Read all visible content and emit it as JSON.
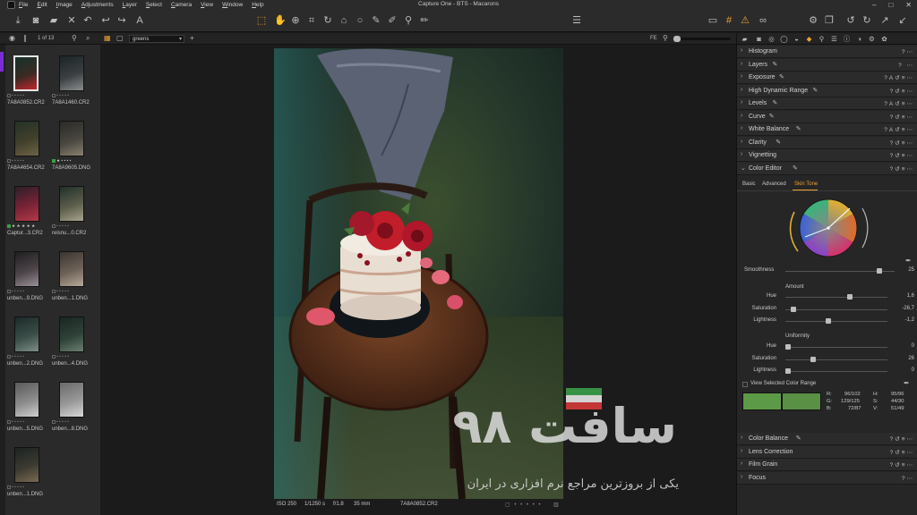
{
  "app": {
    "title": "Capture One - BTS - Macarons",
    "menu": [
      "File",
      "Edit",
      "Image",
      "Adjustments",
      "Layer",
      "Select",
      "Camera",
      "View",
      "Window",
      "Help"
    ],
    "window_controls": [
      "–",
      "□",
      "✕"
    ]
  },
  "browser_bar": {
    "counter": "1 of 13",
    "collection": "greens",
    "filter_label": "FE"
  },
  "thumbnails": [
    {
      "name": "7A8A0852.CR2",
      "stars": 0,
      "label": "",
      "selected": true,
      "colors": [
        "#16322b",
        "#3a2a24",
        "#c2262c"
      ]
    },
    {
      "name": "7A8A1460.CR2",
      "stars": 0,
      "label": "",
      "selected": false,
      "colors": [
        "#1c2426",
        "#3b3f42",
        "#8b8e8e"
      ]
    },
    {
      "name": "7A8A4654.CR2",
      "stars": 0,
      "label": "",
      "selected": false,
      "colors": [
        "#243126",
        "#42402c",
        "#6d6345"
      ]
    },
    {
      "name": "7A8A9605.DNG",
      "stars": 1,
      "label": "green",
      "selected": false,
      "colors": [
        "#2a2a26",
        "#48463f",
        "#8a8070"
      ]
    },
    {
      "name": "Captur...3.CR2",
      "stars": 5,
      "label": "green",
      "selected": false,
      "colors": [
        "#2b2028",
        "#7a2236",
        "#b23a4a"
      ]
    },
    {
      "name": "reisnu...0.CR2",
      "stars": 0,
      "label": "",
      "selected": false,
      "colors": [
        "#223028",
        "#5c5e4c",
        "#a9a38e"
      ]
    },
    {
      "name": "unben...9.DNG",
      "stars": 0,
      "label": "",
      "selected": false,
      "colors": [
        "#1f1e20",
        "#4c4448",
        "#9b9098"
      ]
    },
    {
      "name": "unben...1.DNG",
      "stars": 0,
      "label": "",
      "selected": false,
      "colors": [
        "#3a3430",
        "#6e6258",
        "#b8a898"
      ]
    },
    {
      "name": "unben...2.DNG",
      "stars": 0,
      "label": "",
      "selected": false,
      "colors": [
        "#1d2a2a",
        "#3a4e48",
        "#7e8c88"
      ]
    },
    {
      "name": "unben...4.DNG",
      "stars": 0,
      "label": "",
      "selected": false,
      "colors": [
        "#1a2622",
        "#2e4238",
        "#6a7e70"
      ]
    },
    {
      "name": "unben...5.DNG",
      "stars": 0,
      "label": "",
      "selected": false,
      "colors": [
        "#5a5a5a",
        "#8c8c8c",
        "#cfcfcf"
      ]
    },
    {
      "name": "unben...8.DNG",
      "stars": 0,
      "label": "",
      "selected": false,
      "colors": [
        "#6a6a6a",
        "#989898",
        "#d8d8d8"
      ]
    },
    {
      "name": "unben...1.DNG",
      "stars": 0,
      "label": "",
      "selected": false,
      "colors": [
        "#1c2322",
        "#3c3a32",
        "#7a6a52"
      ]
    }
  ],
  "viewer": {
    "iso": "ISO 250",
    "shutter": "1/1250 s",
    "aperture": "f/1.8",
    "focal": "35 mm",
    "filename": "7A8A0852.CR2"
  },
  "watermark": {
    "main": "سافت ۹۸",
    "sub": "یکی از بروزترین مراجع نرم افزاری در ایران"
  },
  "tools": {
    "headers_top": [
      {
        "name": "Histogram",
        "pencil": false,
        "actions": "?⋯"
      },
      {
        "name": "Layers",
        "pencil": true,
        "actions": "? ⋯"
      },
      {
        "name": "Exposure",
        "pencil": true,
        "actions": "?A↺≡⋯"
      },
      {
        "name": "High Dynamic Range",
        "pencil": true,
        "actions": "?↺≡⋯"
      },
      {
        "name": "Levels",
        "pencil": true,
        "actions": "?A↺≡⋯"
      },
      {
        "name": "Curve",
        "pencil": true,
        "actions": "?↺≡⋯"
      },
      {
        "name": "White Balance",
        "pencil": true,
        "actions": "?A↺≡⋯"
      },
      {
        "name": "Clarity",
        "pencil": true,
        "actions": "?↺≡⋯"
      },
      {
        "name": "Vignetting",
        "pencil": false,
        "actions": "?↺≡⋯"
      },
      {
        "name": "Color Editor",
        "pencil": true,
        "actions": "?↺≡⋯"
      }
    ],
    "headers_bottom": [
      {
        "name": "Color Balance",
        "pencil": true,
        "actions": "?↺≡⋯"
      },
      {
        "name": "Lens Correction",
        "pencil": false,
        "actions": "?↺≡⋯"
      },
      {
        "name": "Film Grain",
        "pencil": false,
        "actions": "?↺≡⋯"
      },
      {
        "name": "Focus",
        "pencil": false,
        "actions": "?⋯"
      }
    ],
    "color_editor": {
      "tabs": [
        "Basic",
        "Advanced",
        "Skin Tone"
      ],
      "active_tab": "Skin Tone",
      "smoothness": {
        "label": "Smoothness",
        "value": "25",
        "position": 0.88
      },
      "amount_label": "Amount",
      "amount": [
        {
          "label": "Hue",
          "value": "1,6",
          "position": 0.64
        },
        {
          "label": "Saturation",
          "value": "-26,7",
          "position": 0.06
        },
        {
          "label": "Lightness",
          "value": "-1,2",
          "position": 0.42
        }
      ],
      "uniformity_label": "Uniformity",
      "uniformity": [
        {
          "label": "Hue",
          "value": "0",
          "position": 0.0
        },
        {
          "label": "Saturation",
          "value": "26",
          "position": 0.26
        },
        {
          "label": "Lightness",
          "value": "0",
          "position": 0.0
        }
      ],
      "view_selected_label": "View Selected Color Range",
      "swatch_colors": [
        "#5d9a47",
        "#5a8f46"
      ],
      "readouts": {
        "r": "R:",
        "r_val": "96/102",
        "g": "G:",
        "g_val": "129/125",
        "b": "B:",
        "b_val": "72/87",
        "h": "H:",
        "h_val": "95/96",
        "s": "S:",
        "s_val": "44/30",
        "v": "V:",
        "v_val": "51/49"
      }
    }
  },
  "colors": {
    "accent": "#f0a030",
    "panel": "#262626",
    "menubar": "#2b2b2b"
  }
}
